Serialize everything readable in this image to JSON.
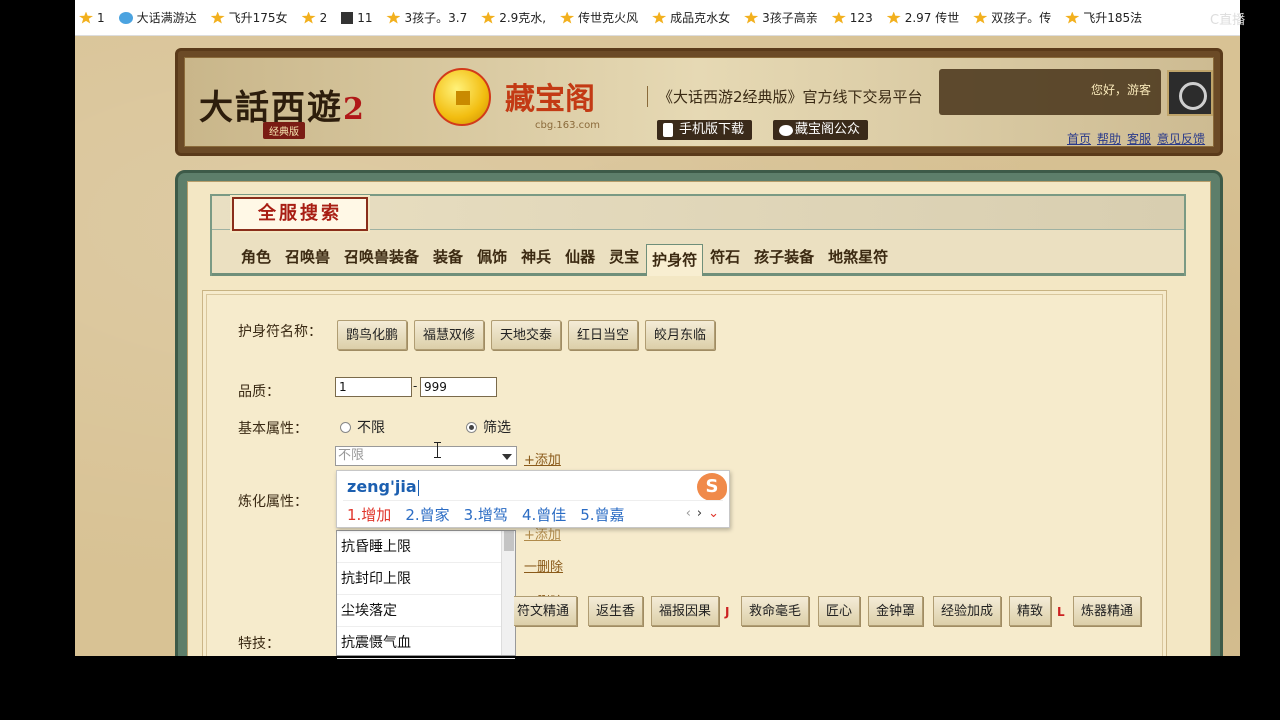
{
  "browser": {
    "bookmarks": [
      {
        "label": "1",
        "icon": "star-icon"
      },
      {
        "label": "大话满游达",
        "icon": "bird-icon"
      },
      {
        "label": "飞升175女",
        "icon": "star-icon"
      },
      {
        "label": "2",
        "icon": "star-icon"
      },
      {
        "label": "11",
        "icon": "box-icon"
      },
      {
        "label": "3孩子。3.7",
        "icon": "star-icon"
      },
      {
        "label": "2.9克水,",
        "icon": "star-icon"
      },
      {
        "label": "传世克火风",
        "icon": "star-icon"
      },
      {
        "label": "成品克水女",
        "icon": "star-icon"
      },
      {
        "label": "3孩子高亲",
        "icon": "star-icon"
      },
      {
        "label": "123",
        "icon": "star-icon"
      },
      {
        "label": "2.97 传世",
        "icon": "star-icon"
      },
      {
        "label": "双孩子。传",
        "icon": "star-icon"
      },
      {
        "label": "飞升185法",
        "icon": "star-icon"
      }
    ],
    "corner_label": "C直播"
  },
  "header": {
    "game_logo": "大話西遊",
    "game_logo_number": "2",
    "game_edition": "经典版",
    "site_logo": "藏宝阁",
    "site_domain": "cbg.163.com",
    "platform_text": "《大话西游2经典版》官方线下交易平台",
    "mobile_download": "手机版下载",
    "wechat_account": "藏宝阁公众",
    "greeting": "您好，游客",
    "links": [
      "首页",
      "帮助",
      "客服",
      "意见反馈"
    ]
  },
  "search": {
    "panel_title": "全服搜索",
    "tabs": [
      "角色",
      "召唤兽",
      "召唤兽装备",
      "装备",
      "佩饰",
      "神兵",
      "仙器",
      "灵宝",
      "护身符",
      "符石",
      "孩子装备",
      "地煞星符"
    ],
    "active_tab": "护身符",
    "name_label": "护身符名称：",
    "name_options": [
      "鹍鸟化鹏",
      "福慧双修",
      "天地交泰",
      "红日当空",
      "皎月东临"
    ],
    "quality_label": "品质：",
    "quality_min": "1",
    "quality_max": "999",
    "quality_sep": "-",
    "basic_attr_label": "基本属性：",
    "radio_unlimited": "不限",
    "radio_filter": "筛选",
    "radio_selected": "筛选",
    "select_value": "不限",
    "add_link": "+添加",
    "refine_attr_label": "炼化属性：",
    "hidden_add_link": "+添加",
    "delete_link_1": "一删除",
    "delete_link_2": "一删除",
    "dropdown_items": [
      "抗昏睡上限",
      "抗封印上限",
      "尘埃落定",
      "抗震慑气血"
    ],
    "skill_label": "特技：",
    "skills": [
      "符文精通",
      "返生香",
      "福报因果",
      "救命毫毛",
      "匠心",
      "金钟罩",
      "经验加成",
      "精致",
      "炼器精通"
    ],
    "skill_tags": [
      "J",
      "L"
    ]
  },
  "ime": {
    "pinyin": "zeng'jia",
    "candidates": [
      "1.增加",
      "2.曾家",
      "3.增驾",
      "4.曾佳",
      "5.曾嘉"
    ],
    "logo": "S",
    "nav": [
      "‹",
      "›",
      "⌄"
    ]
  },
  "colors": {
    "accent_red": "#a81e14",
    "panel_green": "#5d7e6a",
    "parchment": "#f3e7c4",
    "ime_blue": "#2b6cc4",
    "ime_red": "#e0362c"
  }
}
